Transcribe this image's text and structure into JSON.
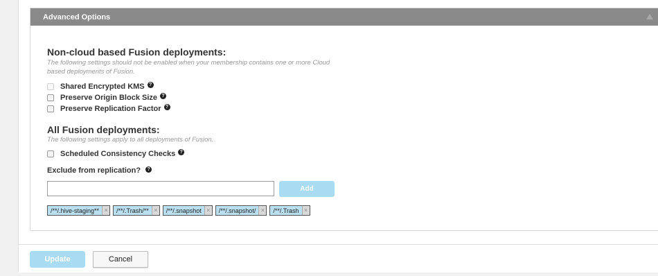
{
  "panel": {
    "title": "Advanced Options"
  },
  "non_cloud": {
    "title": "Non-cloud based Fusion deployments:",
    "description": "The following settings should not be enabled when your membership contains one or more Cloud based deployments of Fusion.",
    "options": [
      {
        "label": "Shared Encrypted KMS",
        "checked": false,
        "disabled": true
      },
      {
        "label": "Preserve Origin Block Size",
        "checked": false,
        "disabled": false
      },
      {
        "label": "Preserve Replication Factor",
        "checked": false,
        "disabled": false
      }
    ]
  },
  "all_fusion": {
    "title": "All Fusion deployments:",
    "description": "The following settings apply to all deployments of Fusion.",
    "options": [
      {
        "label": "Scheduled Consistency Checks",
        "checked": false,
        "disabled": false
      }
    ]
  },
  "exclude": {
    "label": "Exclude from replication?",
    "input_value": "",
    "add_label": "Add",
    "tags": [
      "/**/.hive-staging**",
      "/**/.Trash/**",
      "/**/.snapshot",
      "/**/.snapshot/",
      "/**/.Trash"
    ],
    "remove_glyph": "×"
  },
  "footer": {
    "update_label": "Update",
    "cancel_label": "Cancel"
  },
  "help_glyph": "?"
}
